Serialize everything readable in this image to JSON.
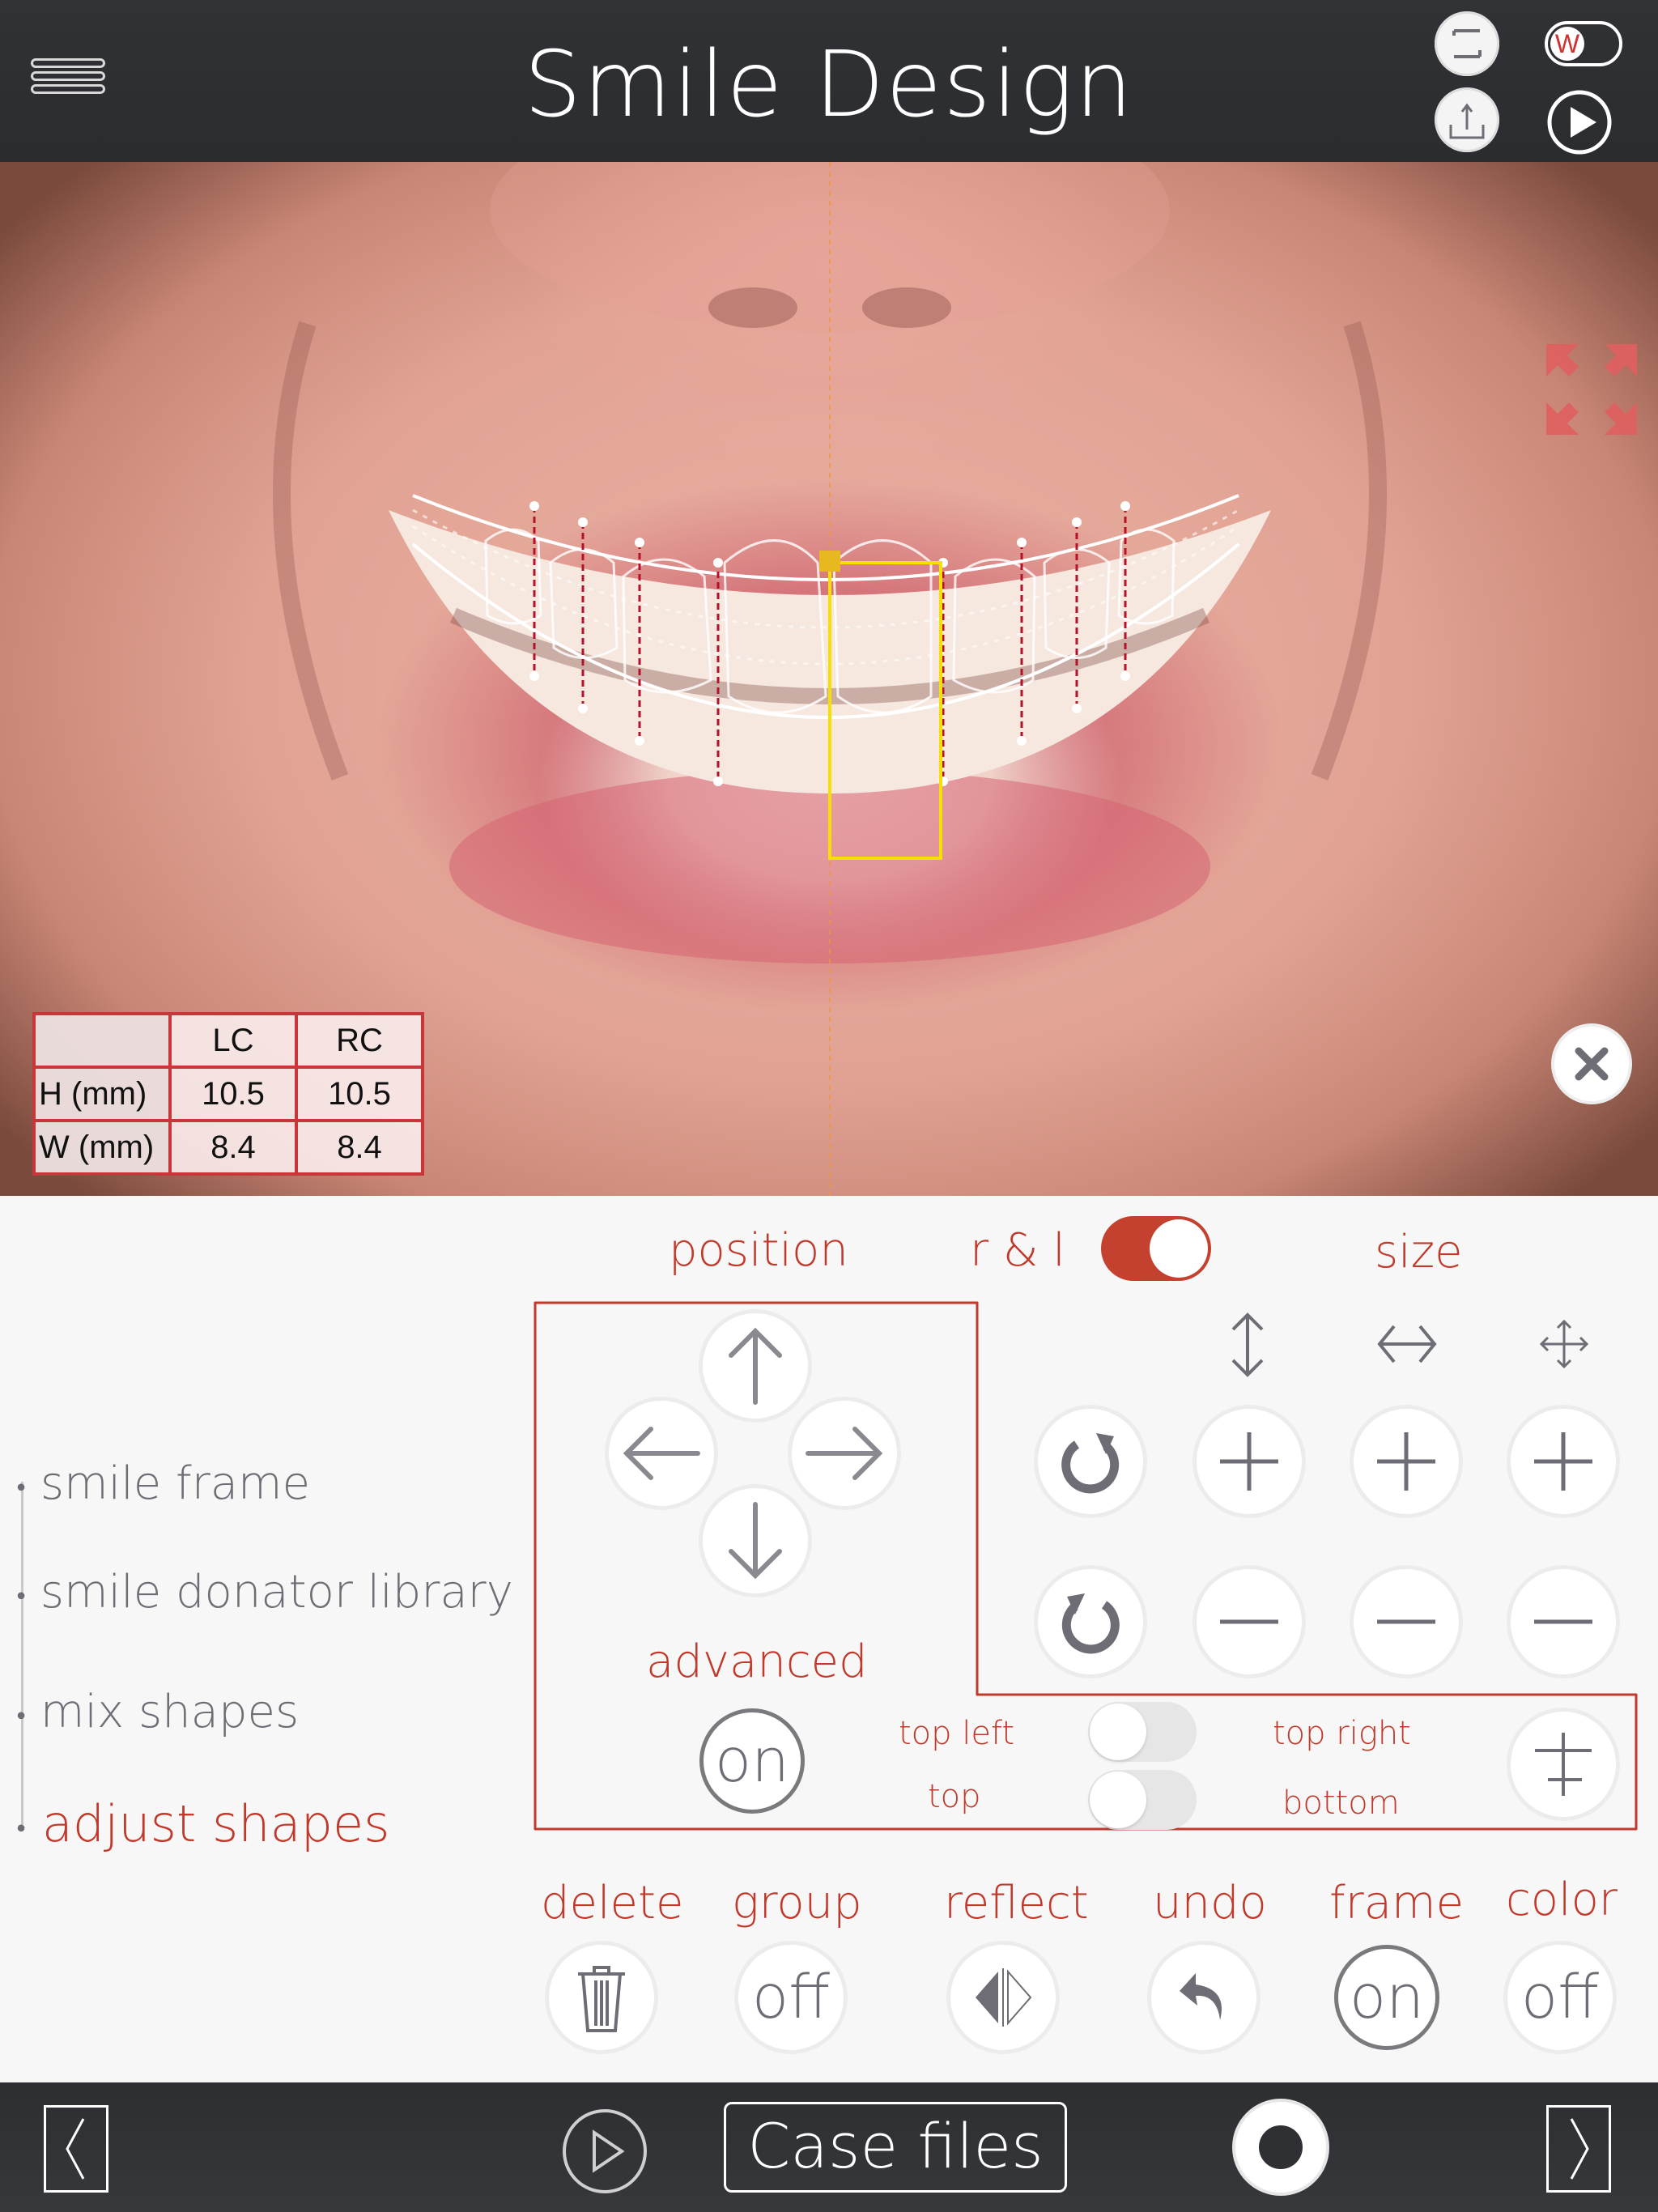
{
  "header": {
    "title": "Smile Design",
    "menu_icon": "hamburger-menu-icon",
    "actions": [
      {
        "name": "crop-frame-button",
        "icon": "crop-frame-icon"
      },
      {
        "name": "watermark-toggle",
        "icon": "w-toggle-icon",
        "label": "W",
        "state": "off"
      },
      {
        "name": "share-button",
        "icon": "share-icon"
      },
      {
        "name": "play-presentation-button",
        "icon": "play-icon"
      }
    ]
  },
  "photo": {
    "fullscreen_icon": "expand-arrows-icon",
    "close_icon": "close-icon",
    "measurements": {
      "columns": [
        "",
        "LC",
        "RC"
      ],
      "rows": [
        {
          "label": "H (mm)",
          "values": [
            "10.5",
            "10.5"
          ]
        },
        {
          "label": "W (mm)",
          "values": [
            "8.4",
            "8.4"
          ]
        }
      ]
    }
  },
  "steps": [
    {
      "label": "smile frame",
      "active": false
    },
    {
      "label": "smile donator library",
      "active": false
    },
    {
      "label": "mix shapes",
      "active": false
    },
    {
      "label": "adjust shapes",
      "active": true
    }
  ],
  "controls": {
    "position_label": "position",
    "rl_label": "r & l",
    "rl_toggle": "on",
    "size_label": "size",
    "advanced_label": "advanced",
    "advanced_button": "on",
    "top_left_label": "top left",
    "top_right_label": "top right",
    "top_label": "top",
    "bottom_label": "bottom",
    "toggle_top": "off",
    "toggle_bottom": "off"
  },
  "actions": [
    {
      "label": "delete",
      "value": ""
    },
    {
      "label": "group",
      "value": "off"
    },
    {
      "label": "reflect",
      "value": ""
    },
    {
      "label": "undo",
      "value": ""
    },
    {
      "label": "frame",
      "value": "on"
    },
    {
      "label": "color",
      "value": "off"
    }
  ],
  "bottom": {
    "case_files": "Case files"
  },
  "colors": {
    "accent": "#c0392b",
    "header_bg": "#2e3034",
    "panel_bg": "#f7f7f7",
    "icon_gray": "#6e6d75",
    "highlight_yellow": "#f5e000"
  }
}
